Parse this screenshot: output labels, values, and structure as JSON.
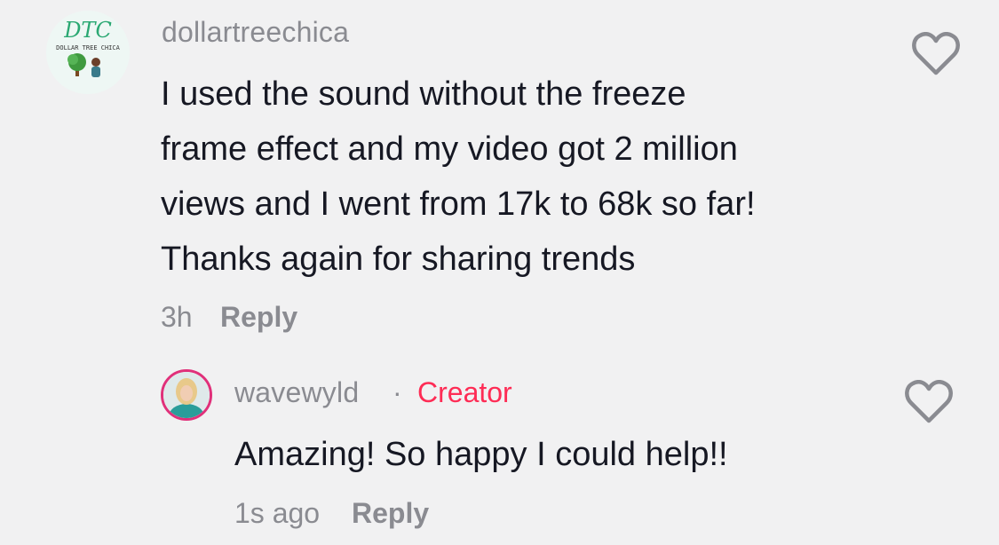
{
  "comments": [
    {
      "username": "dollartreechica",
      "avatar_text_main": "DTC",
      "avatar_text_sub": "DOLLAR TREE CHICA",
      "lines": [
        "I used the sound without the freeze",
        "frame effect and my video got 2 million",
        "views and I went from 17k to 68k so far!",
        "Thanks again for sharing trends"
      ],
      "time": "3h",
      "reply_label": "Reply",
      "icon": "heart-outline-icon"
    },
    {
      "username": "wavewyld",
      "separator": "·",
      "badge": "Creator",
      "lines": [
        "Amazing! So happy I could help!!"
      ],
      "time": "1s ago",
      "reply_label": "Reply",
      "icon": "heart-outline-icon"
    }
  ],
  "colors": {
    "background": "#f1f1f2",
    "muted_text": "#8a8b91",
    "creator_badge": "#fe2c55",
    "avatar_ring": "#e0307a"
  }
}
